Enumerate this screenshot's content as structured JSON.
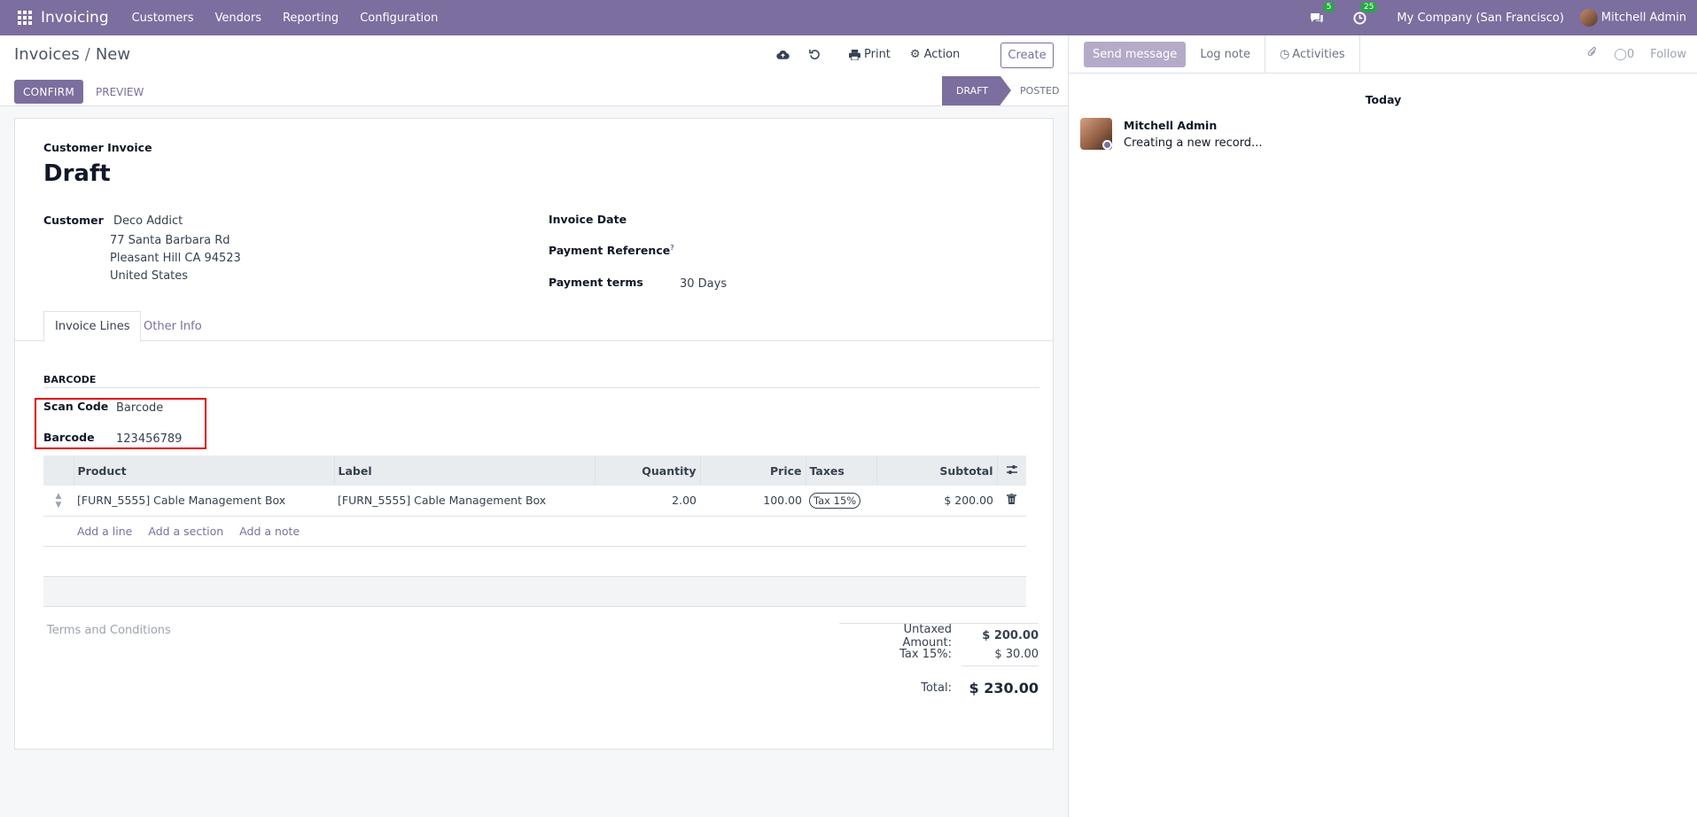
{
  "nav": {
    "app_name": "Invoicing",
    "menu": [
      "Customers",
      "Vendors",
      "Reporting",
      "Configuration"
    ],
    "messages_count": "5",
    "activities_count": "25",
    "company": "My Company (San Francisco)",
    "user": "Mitchell Admin"
  },
  "control": {
    "breadcrumb_parent": "Invoices",
    "breadcrumb_sep": "/",
    "breadcrumb_current": "New",
    "print_label": "Print",
    "action_label": "Action",
    "create_label": "Create",
    "confirm_label": "CONFIRM",
    "preview_label": "PREVIEW",
    "stages": [
      "DRAFT",
      "POSTED"
    ]
  },
  "form": {
    "type": "Customer Invoice",
    "name": "Draft",
    "customer_label": "Customer",
    "customer_name": "Deco Addict",
    "address": [
      "77 Santa Barbara Rd",
      "Pleasant Hill CA 94523",
      "United States"
    ],
    "invoice_date_label": "Invoice Date",
    "payment_ref_label": "Payment Reference",
    "payment_ref_tooltip": "?",
    "payment_terms_label": "Payment terms",
    "payment_terms_value": "30 Days",
    "tabs": [
      "Invoice Lines",
      "Other Info"
    ],
    "barcode_section": "BARCODE",
    "scan_code_label": "Scan Code",
    "scan_code_value": "Barcode",
    "barcode_label": "Barcode",
    "barcode_value": "123456789"
  },
  "lines": {
    "headers": [
      "Product",
      "Label",
      "Quantity",
      "Price",
      "Taxes",
      "Subtotal"
    ],
    "rows": [
      {
        "product": "[FURN_5555] Cable Management Box",
        "label": "[FURN_5555] Cable Management Box",
        "quantity": "2.00",
        "price": "100.00",
        "tax": "Tax 15%",
        "subtotal": "$ 200.00"
      }
    ],
    "add_line": "Add a line",
    "add_section": "Add a section",
    "add_note": "Add a note"
  },
  "terms_placeholder": "Terms and Conditions",
  "totals": {
    "untaxed_label": "Untaxed Amount:",
    "untaxed_value": "$ 200.00",
    "tax_label": "Tax 15%:",
    "tax_value": "$ 30.00",
    "total_label": "Total:",
    "total_value": "$ 230.00"
  },
  "chatter": {
    "send_message": "Send message",
    "log_note": "Log note",
    "activities": "Activities",
    "followers_count": "0",
    "follow": "Follow",
    "day_label": "Today",
    "author": "Mitchell Admin",
    "message": "Creating a new record..."
  },
  "colors": {
    "brand": "#7c6e9f",
    "badge": "#27a745",
    "highlight": "#e00000"
  }
}
